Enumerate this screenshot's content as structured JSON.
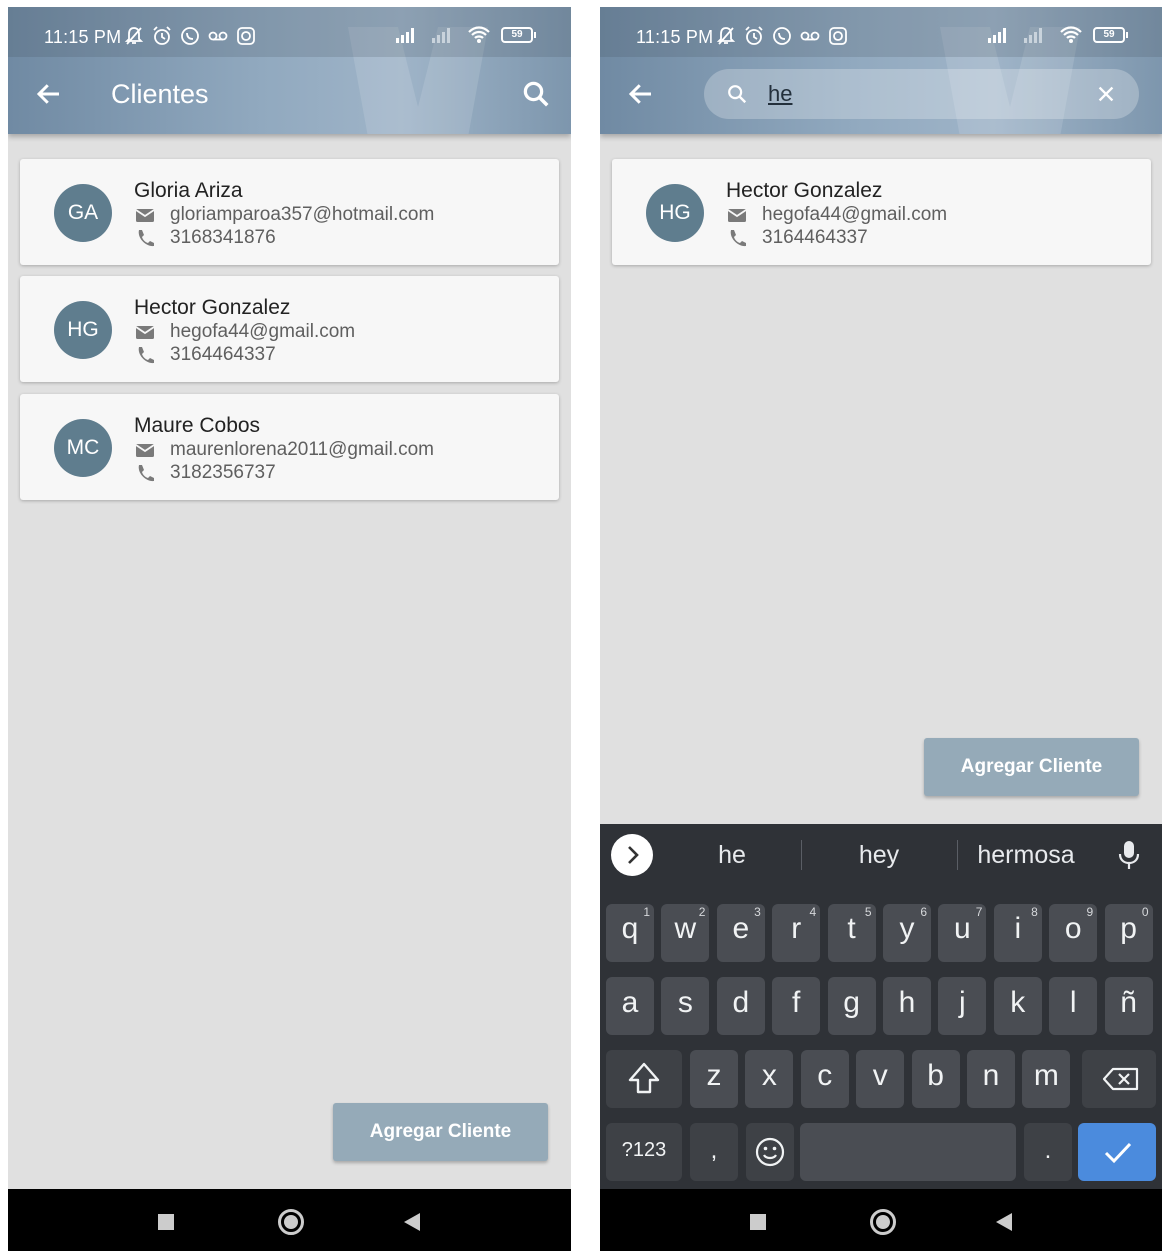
{
  "status": {
    "time": "11:15 PM",
    "battery": "59"
  },
  "left": {
    "title": "Clientes",
    "clients": [
      {
        "initials": "GA",
        "name": "Gloria Ariza",
        "email": "gloriamparoa357@hotmail.com",
        "phone": "3168341876"
      },
      {
        "initials": "HG",
        "name": "Hector Gonzalez",
        "email": "hegofa44@gmail.com",
        "phone": "3164464337"
      },
      {
        "initials": "MC",
        "name": "Maure Cobos",
        "email": "maurenlorena2011@gmail.com",
        "phone": "3182356737"
      }
    ],
    "add_button": "Agregar Cliente"
  },
  "right": {
    "search": {
      "value": "he"
    },
    "clients": [
      {
        "initials": "HG",
        "name": "Hector Gonzalez",
        "email": "hegofa44@gmail.com",
        "phone": "3164464337"
      }
    ],
    "add_button": "Agregar Cliente",
    "keyboard": {
      "suggestions": [
        "he",
        "hey",
        "hermosa"
      ],
      "row1": [
        {
          "k": "q",
          "n": "1"
        },
        {
          "k": "w",
          "n": "2"
        },
        {
          "k": "e",
          "n": "3"
        },
        {
          "k": "r",
          "n": "4"
        },
        {
          "k": "t",
          "n": "5"
        },
        {
          "k": "y",
          "n": "6"
        },
        {
          "k": "u",
          "n": "7"
        },
        {
          "k": "i",
          "n": "8"
        },
        {
          "k": "o",
          "n": "9"
        },
        {
          "k": "p",
          "n": "0"
        }
      ],
      "row2": [
        "a",
        "s",
        "d",
        "f",
        "g",
        "h",
        "j",
        "k",
        "l",
        "ñ"
      ],
      "row3": [
        "z",
        "x",
        "c",
        "v",
        "b",
        "n",
        "m"
      ],
      "symbols": "?123",
      "comma": ",",
      "period": "."
    }
  },
  "colors": {
    "appbar": "#8aa3b9",
    "avatar": "#5f7d8e",
    "button": "#95aab8",
    "keyboard": "#2f3237",
    "enter": "#4b8bdd"
  },
  "icons": [
    "back-arrow-icon",
    "search-icon",
    "close-icon",
    "email-icon",
    "phone-icon",
    "mic-icon",
    "shift-icon",
    "backspace-icon",
    "emoji-icon",
    "check-icon",
    "chevron-right-icon"
  ]
}
